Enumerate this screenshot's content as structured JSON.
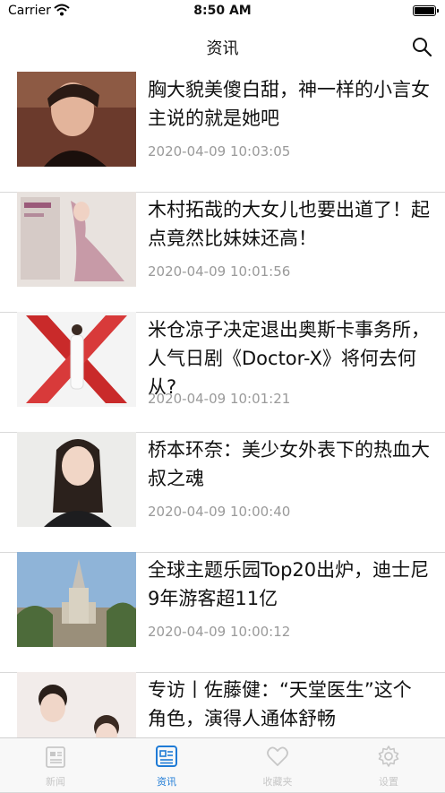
{
  "status_bar": {
    "carrier": "Carrier",
    "time": "8:50 AM"
  },
  "nav": {
    "title": "资讯",
    "search_icon": "search-icon"
  },
  "news": [
    {
      "headline": "胸大貌美傻白甜，神一样的小言女主说的就是她吧",
      "date": "2020-04-09 10:03:05"
    },
    {
      "headline": "木村拓哉的大女儿也要出道了！起点竟然比妹妹还高！",
      "date": "2020-04-09 10:01:56"
    },
    {
      "headline": "米仓凉子决定退出奥斯卡事务所，人气日剧《Doctor-X》将何去何从?",
      "date": "2020-04-09 10:01:21"
    },
    {
      "headline": "桥本环奈：美少女外表下的热血大叔之魂",
      "date": "2020-04-09 10:00:40"
    },
    {
      "headline": "全球主题乐园Top20出炉，迪士尼9年游客超11亿",
      "date": "2020-04-09 10:00:12"
    },
    {
      "headline": "专访丨佐藤健：“天堂医生”这个角色，演得人通体舒畅",
      "date": ""
    }
  ],
  "tabs": [
    {
      "label": "新闻",
      "icon": "newspaper-icon",
      "active": false
    },
    {
      "label": "资讯",
      "icon": "news-list-icon",
      "active": true
    },
    {
      "label": "收藏夹",
      "icon": "heart-icon",
      "active": false
    },
    {
      "label": "设置",
      "icon": "gear-icon",
      "active": false
    }
  ],
  "colors": {
    "accent": "#1f7bd6",
    "inactive": "#c7c7c7",
    "date": "#9a9a9a"
  }
}
